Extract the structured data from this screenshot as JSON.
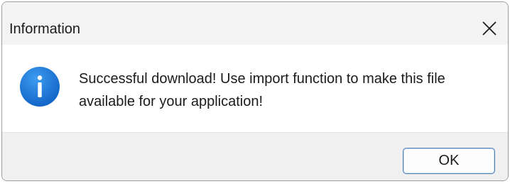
{
  "window": {
    "title": "Information",
    "close_icon": "close-icon"
  },
  "dialog": {
    "icon": "info-icon",
    "message": "Successful download! Use import function to make this file available for your application!"
  },
  "buttons": {
    "ok_label": "OK"
  },
  "colors": {
    "icon_blue": "#1675d6",
    "button_border": "#4e81b8",
    "footer_bg": "#f0f0f0",
    "titlebar_bg": "#f3f3f3"
  }
}
